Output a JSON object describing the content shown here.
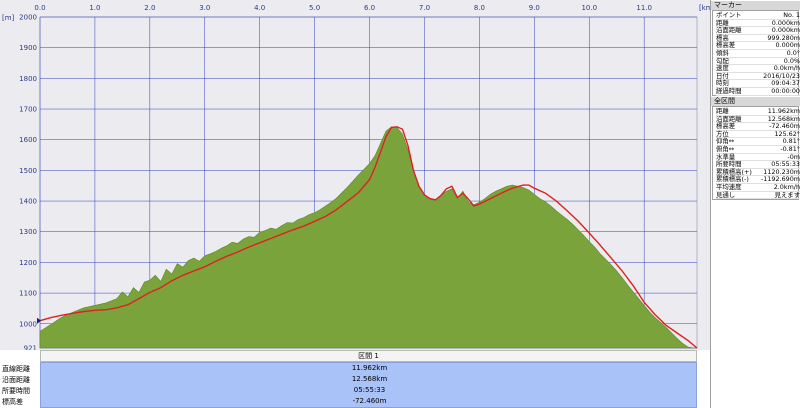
{
  "chart_data": {
    "type": "area",
    "x_unit": "[km]",
    "y_unit": "[m]",
    "xlim": [
      0,
      11.962
    ],
    "ylim": [
      921,
      2000
    ],
    "x_ticks": [
      "0.0",
      "1.0",
      "2.0",
      "3.0",
      "4.0",
      "5.0",
      "6.0",
      "7.0",
      "8.0",
      "9.0",
      "10.0",
      "11.0"
    ],
    "y_ticks": [
      "2000",
      "1900",
      "1800",
      "1700",
      "1600",
      "1500",
      "1400",
      "1300",
      "1200",
      "1100",
      "1000",
      "921"
    ],
    "grid": true,
    "colors": {
      "fill": "#7ba33c",
      "fill_dark": "#5c8a28",
      "line": "#e02020",
      "grid": "#3040c0",
      "background": "#ececf0"
    },
    "series": [
      {
        "kind": "terrain",
        "x": [
          0,
          0.2,
          0.4,
          0.6,
          0.8,
          1.0,
          1.2,
          1.4,
          1.5,
          1.6,
          1.7,
          1.8,
          1.9,
          2.0,
          2.1,
          2.2,
          2.3,
          2.4,
          2.5,
          2.6,
          2.7,
          2.8,
          2.9,
          3.0,
          3.1,
          3.2,
          3.3,
          3.4,
          3.5,
          3.6,
          3.7,
          3.8,
          3.9,
          4.0,
          4.1,
          4.2,
          4.3,
          4.4,
          4.5,
          4.6,
          4.7,
          4.8,
          4.9,
          5.0,
          5.1,
          5.2,
          5.3,
          5.4,
          5.5,
          5.6,
          5.7,
          5.8,
          5.9,
          6.0,
          6.1,
          6.2,
          6.3,
          6.4,
          6.5,
          6.6,
          6.7,
          6.8,
          6.9,
          7.0,
          7.1,
          7.2,
          7.3,
          7.4,
          7.5,
          7.6,
          7.7,
          7.8,
          7.9,
          8.0,
          8.1,
          8.2,
          8.3,
          8.4,
          8.5,
          8.6,
          8.7,
          8.8,
          8.9,
          9.0,
          9.1,
          9.2,
          9.3,
          9.4,
          9.5,
          9.6,
          9.7,
          9.8,
          9.9,
          10.0,
          10.1,
          10.2,
          10.3,
          10.4,
          10.5,
          10.6,
          10.7,
          10.8,
          10.9,
          11.0,
          11.1,
          11.2,
          11.3,
          11.4,
          11.5,
          11.6,
          11.7,
          11.8,
          11.9,
          11.962
        ],
        "y": [
          975,
          998,
          1022,
          1038,
          1052,
          1060,
          1068,
          1082,
          1104,
          1088,
          1118,
          1102,
          1136,
          1142,
          1158,
          1138,
          1178,
          1162,
          1196,
          1184,
          1206,
          1214,
          1204,
          1222,
          1228,
          1236,
          1246,
          1254,
          1266,
          1262,
          1276,
          1284,
          1282,
          1298,
          1304,
          1312,
          1308,
          1320,
          1330,
          1328,
          1340,
          1346,
          1356,
          1362,
          1372,
          1384,
          1396,
          1410,
          1428,
          1446,
          1466,
          1486,
          1504,
          1522,
          1548,
          1588,
          1628,
          1642,
          1640,
          1618,
          1566,
          1498,
          1448,
          1418,
          1406,
          1402,
          1418,
          1432,
          1440,
          1408,
          1432,
          1396,
          1388,
          1396,
          1408,
          1422,
          1432,
          1440,
          1448,
          1452,
          1448,
          1444,
          1436,
          1422,
          1408,
          1398,
          1384,
          1368,
          1354,
          1340,
          1324,
          1306,
          1288,
          1268,
          1250,
          1228,
          1210,
          1192,
          1172,
          1150,
          1126,
          1104,
          1082,
          1060,
          1038,
          1020,
          1004,
          988,
          970,
          952,
          936,
          924,
          921,
          921
        ]
      },
      {
        "kind": "track",
        "x": [
          0,
          0.2,
          0.4,
          0.6,
          0.8,
          1.0,
          1.2,
          1.4,
          1.6,
          1.8,
          2.0,
          2.2,
          2.4,
          2.6,
          2.8,
          3.0,
          3.2,
          3.4,
          3.6,
          3.8,
          4.0,
          4.2,
          4.4,
          4.6,
          4.8,
          5.0,
          5.2,
          5.4,
          5.6,
          5.8,
          6.0,
          6.1,
          6.2,
          6.3,
          6.4,
          6.5,
          6.6,
          6.7,
          6.8,
          6.9,
          7.0,
          7.1,
          7.2,
          7.3,
          7.4,
          7.5,
          7.6,
          7.7,
          7.8,
          7.9,
          8.0,
          8.2,
          8.4,
          8.6,
          8.8,
          8.9,
          9.0,
          9.2,
          9.4,
          9.6,
          9.8,
          10.0,
          10.2,
          10.4,
          10.6,
          10.8,
          11.0,
          11.2,
          11.4,
          11.6,
          11.8,
          11.962
        ],
        "y": [
          1010,
          1020,
          1028,
          1034,
          1040,
          1044,
          1046,
          1052,
          1062,
          1082,
          1102,
          1118,
          1140,
          1158,
          1172,
          1186,
          1204,
          1220,
          1234,
          1250,
          1264,
          1278,
          1292,
          1306,
          1318,
          1334,
          1350,
          1372,
          1400,
          1428,
          1470,
          1510,
          1560,
          1610,
          1640,
          1642,
          1634,
          1580,
          1500,
          1448,
          1420,
          1408,
          1404,
          1418,
          1440,
          1448,
          1412,
          1426,
          1406,
          1384,
          1390,
          1408,
          1426,
          1442,
          1452,
          1452,
          1442,
          1426,
          1400,
          1368,
          1334,
          1296,
          1256,
          1214,
          1172,
          1124,
          1070,
          1030,
          995,
          970,
          945,
          921
        ]
      }
    ]
  },
  "section_bar": {
    "label": "区間 1"
  },
  "stats": {
    "labels": [
      "直線距離",
      "沿面距離",
      "所要時間",
      "標高差"
    ],
    "values": [
      "11.962km",
      "12.568km",
      "05:55:33",
      "-72.460m"
    ]
  },
  "side_panel": {
    "marker_title": "マーカー",
    "marker_rows": [
      {
        "k": "ポイント",
        "v": "No. 1"
      },
      {
        "k": "距離",
        "v": "0.000km"
      },
      {
        "k": "沿面距離",
        "v": "0.000km"
      },
      {
        "k": "標高",
        "v": "999.280m"
      },
      {
        "k": "標高差",
        "v": "0.000m"
      },
      {
        "k": "傾斜",
        "v": "0.0°"
      },
      {
        "k": "勾配",
        "v": "0.0%"
      },
      {
        "k": "速度",
        "v": "0.0km/h"
      },
      {
        "k": "日付",
        "v": "2016/10/23"
      },
      {
        "k": "時刻",
        "v": "09:04:37"
      },
      {
        "k": "経過時間",
        "v": "00:00:00"
      }
    ],
    "section_title": "全区間",
    "section_rows": [
      {
        "k": "距離",
        "v": "11.962km"
      },
      {
        "k": "沿面距離",
        "v": "12.568km"
      },
      {
        "k": "標高差",
        "v": "-72.460m"
      },
      {
        "k": "方位",
        "v": "125.62°"
      },
      {
        "k": "仰角↔",
        "v": "0.81°"
      },
      {
        "k": "俯角↔",
        "v": "-0.81°"
      },
      {
        "k": "水準量",
        "v": "-0m"
      },
      {
        "k": "所要時間",
        "v": "05:55:33"
      },
      {
        "k": "累積標高(+)",
        "v": "1120.230m"
      },
      {
        "k": "累積標高(-)",
        "v": "-1192.690m"
      },
      {
        "k": "平均速度",
        "v": "2.0km/h"
      },
      {
        "k": "見通し",
        "v": "見えます"
      }
    ]
  }
}
